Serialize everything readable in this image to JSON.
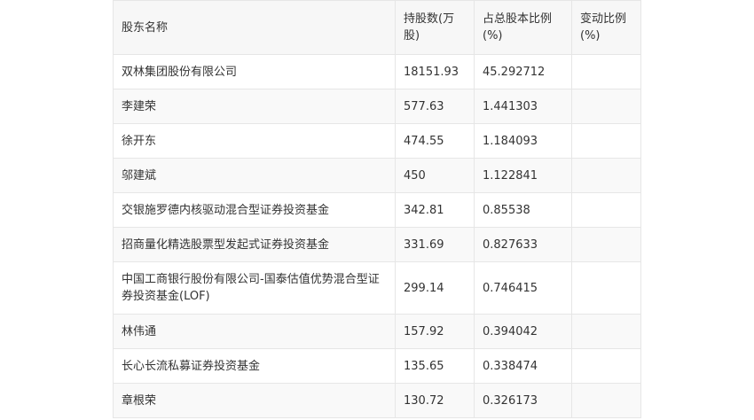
{
  "table": {
    "headers": [
      "股东名称",
      "持股数(万股)",
      "占总股本比例(%)",
      "变动比例(%)"
    ],
    "rows": [
      [
        "双林集团股份有限公司",
        "18151.93",
        "45.292712",
        ""
      ],
      [
        "李建荣",
        "577.63",
        "1.441303",
        ""
      ],
      [
        "徐开东",
        "474.55",
        "1.184093",
        ""
      ],
      [
        "邬建斌",
        "450",
        "1.122841",
        ""
      ],
      [
        "交银施罗德内核驱动混合型证券投资基金",
        "342.81",
        "0.85538",
        ""
      ],
      [
        "招商量化精选股票型发起式证券投资基金",
        "331.69",
        "0.827633",
        ""
      ],
      [
        "中国工商银行股份有限公司-国泰估值优势混合型证券投资基金(LOF)",
        "299.14",
        "0.746415",
        ""
      ],
      [
        "林伟通",
        "157.92",
        "0.394042",
        ""
      ],
      [
        "长心长流私募证券投资基金",
        "135.65",
        "0.338474",
        ""
      ],
      [
        "章根荣",
        "130.72",
        "0.326173",
        ""
      ]
    ]
  }
}
